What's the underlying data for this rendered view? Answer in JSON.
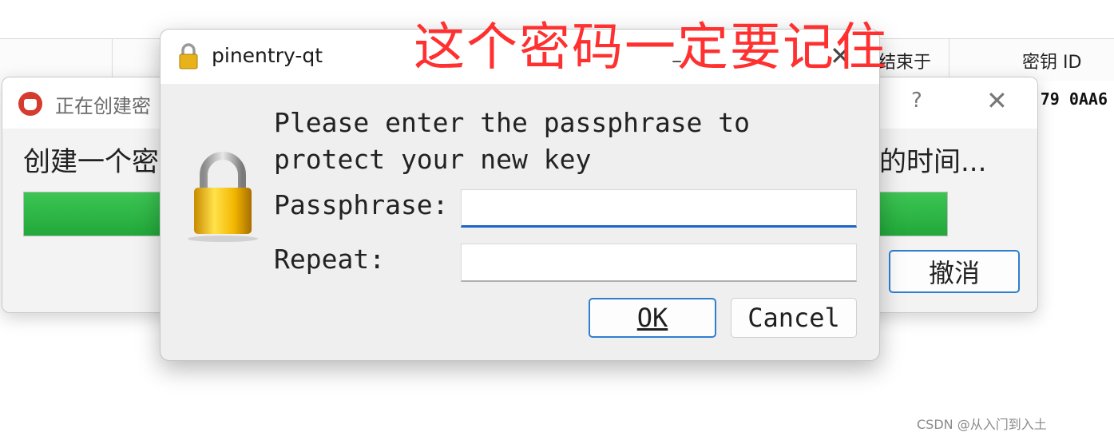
{
  "background_window": {
    "columns": [
      "结束于",
      "密钥 ID"
    ],
    "key_id_fragment": "79 0AA6"
  },
  "progress_dialog": {
    "title": "正在创建密",
    "help_glyph": "?",
    "close_glyph": "✕",
    "message_left": "创建一个密",
    "message_right": "的时间...",
    "progress_fraction": 1.0,
    "cancel_label": "撤消",
    "app_icon": "kleopatra-icon"
  },
  "pinentry": {
    "title": "pinentry-qt",
    "minimize_glyph": "–",
    "close_glyph": "✕",
    "description_line1": "Please enter the passphrase to",
    "description_line2": "protect your new key",
    "passphrase_label": "Passphrase:",
    "passphrase_value": "",
    "repeat_label": "Repeat:",
    "repeat_value": "",
    "ok_label": "OK",
    "cancel_label": "Cancel",
    "lock_icon": "padlock-icon",
    "focus_color": "#1e66c4"
  },
  "annotation": {
    "text": "这个密码一定要记住",
    "color": "#ff3030"
  },
  "watermark": "CSDN @从入门到入土"
}
